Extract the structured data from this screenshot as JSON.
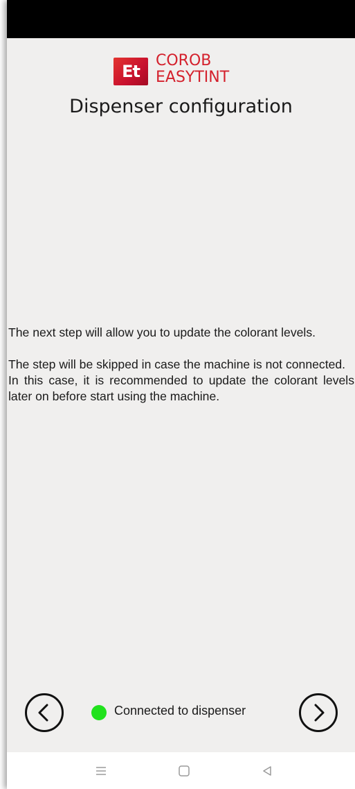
{
  "brand": {
    "mark": "Et",
    "line1": "COROB",
    "line2": "EASYTINT",
    "color": "#d4202c"
  },
  "page": {
    "title": "Dispenser configuration"
  },
  "message": {
    "paragraph1": "The next step will allow you to update the colorant levels.",
    "paragraph2_line1": "The step will be skipped in case the machine is not connected.",
    "paragraph2_line2": "In this case, it is recommended to update the colorant levels later on before start using the machine."
  },
  "footer": {
    "back_icon": "chevron-left-circle-icon",
    "next_icon": "chevron-right-circle-icon",
    "status_text": "Connected to dispenser",
    "status_color": "#21e21d"
  },
  "system_nav": {
    "recents_icon": "menu-lines-icon",
    "home_icon": "home-square-icon",
    "back_icon": "back-triangle-icon"
  }
}
